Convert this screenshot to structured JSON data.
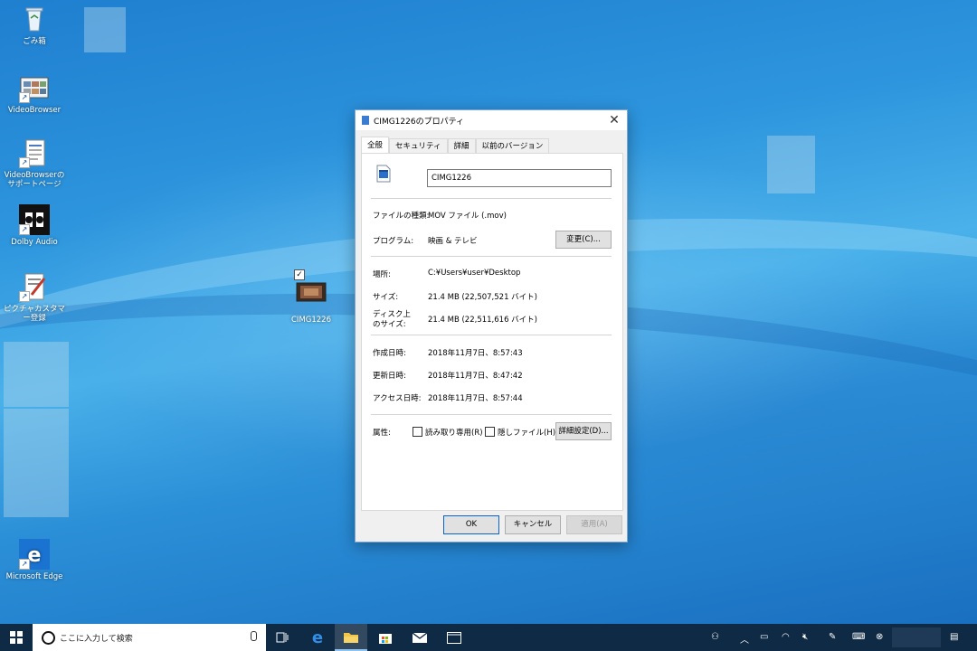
{
  "desktop": {
    "icons": [
      {
        "label": "ごみ箱",
        "icon": "recycle-bin-icon"
      },
      {
        "label": "VideoBrowser",
        "icon": "video-browser-icon"
      },
      {
        "label": "VideoBrowserのサポートページ",
        "icon": "support-page-icon"
      },
      {
        "label": "Dolby Audio",
        "icon": "dolby-icon"
      },
      {
        "label": "ピクチャカスタマー登録",
        "icon": "registration-icon"
      },
      {
        "label": "CIMG1226",
        "icon": "video-file-icon"
      },
      {
        "label": "Microsoft Edge",
        "icon": "edge-icon"
      }
    ]
  },
  "dialog": {
    "title": "CIMG1226のプロパティ",
    "tabs": [
      "全般",
      "セキュリティ",
      "詳細",
      "以前のバージョン"
    ],
    "active_tab": "全般",
    "filename": "CIMG1226",
    "file_type_label": "ファイルの種類:",
    "file_type": "MOV ファイル (.mov)",
    "program_label": "プログラム:",
    "program": "映画 & テレビ",
    "change_button": "変更(C)...",
    "location_label": "場所:",
    "location": "C:¥Users¥user¥Desktop",
    "size_label": "サイズ:",
    "size": "21.4 MB (22,507,521 バイト)",
    "disk_size_label_1": "ディスク上",
    "disk_size_label_2": "のサイズ:",
    "disk_size": "21.4 MB (22,511,616 バイト)",
    "created_label": "作成日時:",
    "created": "2018年11月7日、8:57:43",
    "modified_label": "更新日時:",
    "modified": "2018年11月7日、8:47:42",
    "accessed_label": "アクセス日時:",
    "accessed": "2018年11月7日、8:57:44",
    "attributes_label": "属性:",
    "readonly_label": "読み取り専用(R)",
    "hidden_label": "隠しファイル(H)",
    "advanced_button": "詳細設定(D)...",
    "ok_button": "OK",
    "cancel_button": "キャンセル",
    "apply_button": "適用(A)"
  },
  "taskbar": {
    "search_placeholder": "ここに入力して検索"
  }
}
